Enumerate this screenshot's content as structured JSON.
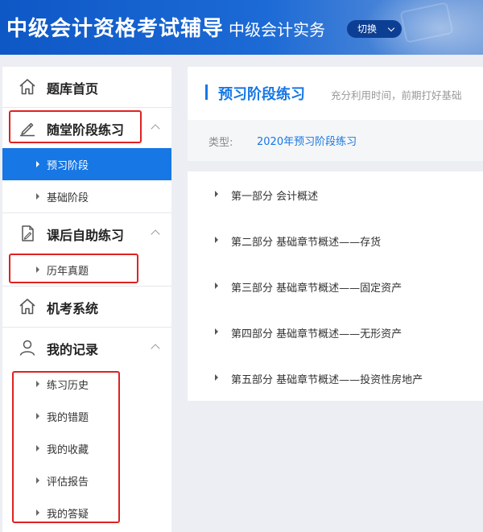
{
  "header": {
    "title": "中级会计资格考试辅导",
    "subtitle": "中级会计实务",
    "switch_label": "切换"
  },
  "sidebar": {
    "home": "题库首页",
    "sections": [
      {
        "label": "随堂阶段练习",
        "items": [
          "预习阶段",
          "基础阶段"
        ]
      },
      {
        "label": "课后自助练习",
        "items": [
          "历年真题"
        ]
      },
      {
        "label": "机考系统",
        "items": []
      },
      {
        "label": "我的记录",
        "items": [
          "练习历史",
          "我的错题",
          "我的收藏",
          "评估报告",
          "我的答疑"
        ]
      }
    ],
    "active_item": "预习阶段"
  },
  "main": {
    "title": "预习阶段练习",
    "description": "充分利用时间，前期打好基础",
    "type_label": "类型:",
    "type_value": "2020年预习阶段练习",
    "chapters": [
      "第一部分 会计概述",
      "第二部分 基础章节概述——存货",
      "第三部分 基础章节概述——固定资产",
      "第四部分 基础章节概述——无形资产",
      "第五部分 基础章节概述——投资性房地产"
    ]
  },
  "colors": {
    "accent": "#1677e5",
    "header_blue": "#0e58c6",
    "highlight_red": "#e02222",
    "background": "#eceef3"
  },
  "icons": [
    "home-icon",
    "pencil-icon",
    "document-edit-icon",
    "home-icon",
    "user-icon",
    "chevron-down-icon",
    "chevron-up-icon",
    "caret-right-icon"
  ]
}
